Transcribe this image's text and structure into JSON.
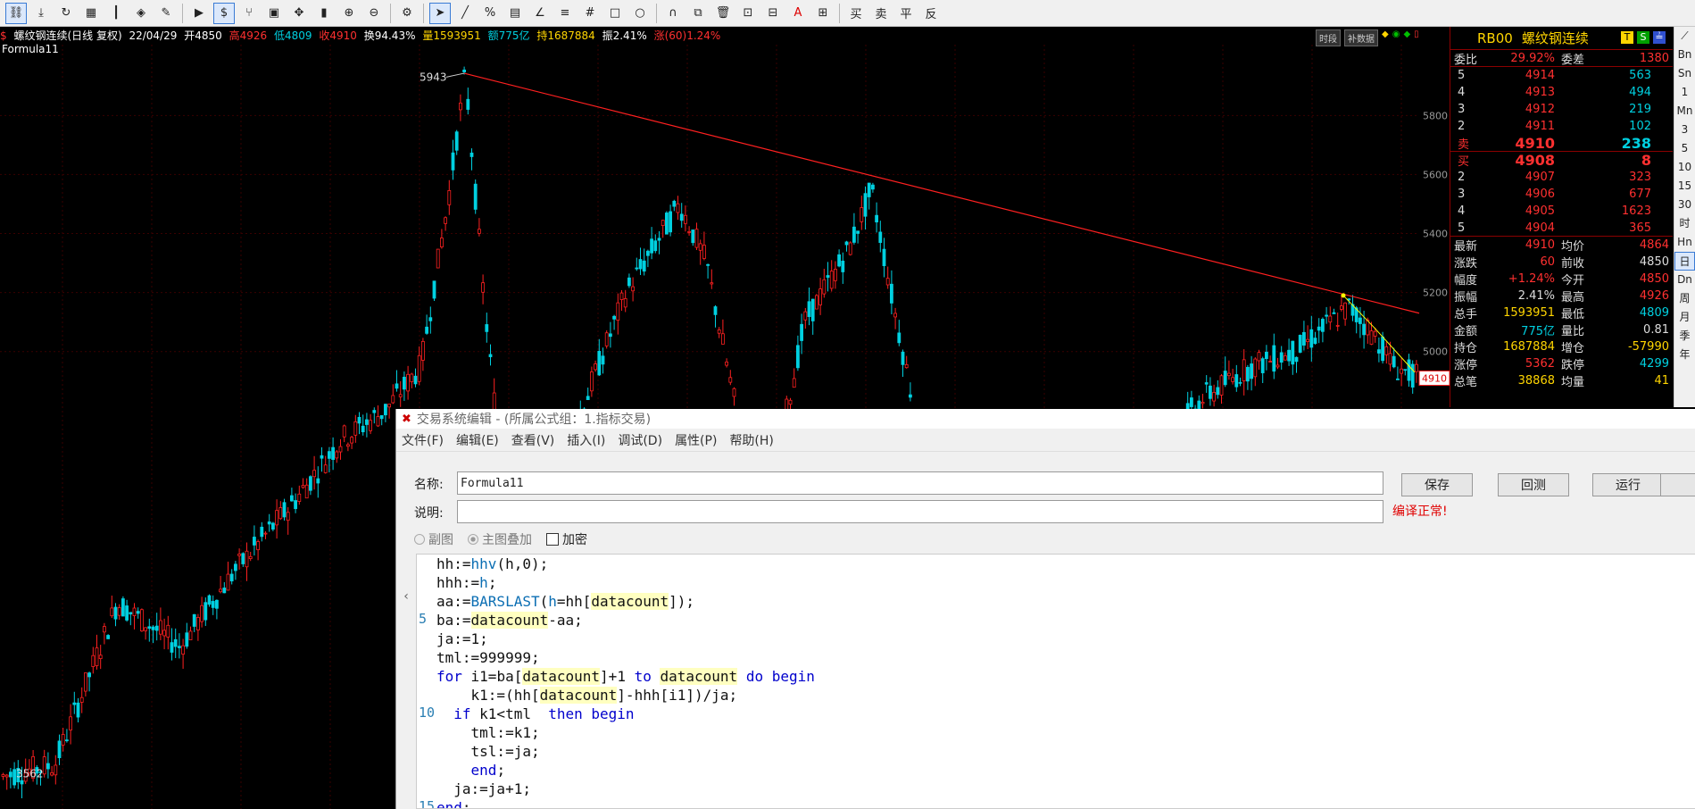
{
  "toolbar": {
    "icons": [
      "link-icon",
      "download-icon",
      "sync-icon",
      "grid-icon",
      "candles-icon",
      "compass-icon",
      "edit-icon",
      "play-icon",
      "dollar-icon",
      "fork-icon",
      "table-icon",
      "move-icon",
      "bar-icon",
      "zoom-in-icon",
      "zoom-out-icon",
      "gear-icon",
      "cursor-icon",
      "line-icon",
      "percent-icon",
      "grid2-icon",
      "angle-icon",
      "channel-icon",
      "hash-icon",
      "rect-icon",
      "circle-icon",
      "magnet-icon",
      "copy-icon",
      "trash-icon",
      "lock-icon",
      "lock2-icon",
      "text-color-icon",
      "save-icon"
    ],
    "text_buttons": [
      "买",
      "卖",
      "平",
      "反"
    ]
  },
  "infobar": {
    "symbol": "螺纹钢连续(日线 复权)",
    "date": "22/04/29",
    "open": "开4850",
    "high": "高4926",
    "low": "低4809",
    "close": "收4910",
    "turnover": "换94.43%",
    "volume": "量1593951",
    "amount": "额775亿",
    "hold": "持1687884",
    "amplitude": "振2.41%",
    "change": "涨(60)1.24%"
  },
  "formula_name": "Formula11",
  "chart_top_btns": [
    "时段",
    "补数据"
  ],
  "chart_labels": {
    "high_label": "5943",
    "low_label": "3562",
    "last_price": "4910"
  },
  "chart_data": {
    "type": "candlestick",
    "y_ticks": [
      5800,
      5600,
      5400,
      5200,
      5000
    ],
    "ylim": [
      3450,
      6040
    ],
    "annotations": [
      "5943",
      "3562",
      "4910"
    ]
  },
  "right_panel": {
    "code": "RB00",
    "name": "螺纹钢连续",
    "weibi": {
      "label": "委比",
      "value": "29.92%",
      "label2": "委差",
      "value2": "1380"
    },
    "asks": [
      {
        "lvl": "5",
        "price": "4914",
        "vol": "563"
      },
      {
        "lvl": "4",
        "price": "4913",
        "vol": "494"
      },
      {
        "lvl": "3",
        "price": "4912",
        "vol": "219"
      },
      {
        "lvl": "2",
        "price": "4911",
        "vol": "102"
      },
      {
        "lvl": "卖",
        "price": "4910",
        "vol": "238"
      }
    ],
    "bids": [
      {
        "lvl": "买",
        "price": "4908",
        "vol": "8"
      },
      {
        "lvl": "2",
        "price": "4907",
        "vol": "323"
      },
      {
        "lvl": "3",
        "price": "4906",
        "vol": "677"
      },
      {
        "lvl": "4",
        "price": "4905",
        "vol": "1623"
      },
      {
        "lvl": "5",
        "price": "4904",
        "vol": "365"
      }
    ],
    "stats": [
      {
        "l1": "最新",
        "v1": "4910",
        "l2": "均价",
        "v2": "4864",
        "c1": "#ff3030",
        "c2": "#ff3030"
      },
      {
        "l1": "涨跌",
        "v1": "60",
        "l2": "前收",
        "v2": "4850",
        "c1": "#ff3030",
        "c2": "#dddddd"
      },
      {
        "l1": "幅度",
        "v1": "+1.24%",
        "l2": "今开",
        "v2": "4850",
        "c1": "#ff3030",
        "c2": "#ff3030"
      },
      {
        "l1": "振幅",
        "v1": "2.41%",
        "l2": "最高",
        "v2": "4926",
        "c1": "#dddddd",
        "c2": "#ff3030"
      },
      {
        "l1": "总手",
        "v1": "1593951",
        "l2": "最低",
        "v2": "4809",
        "c1": "#ffd500",
        "c2": "#00d0e0"
      },
      {
        "l1": "金额",
        "v1": "775亿",
        "l2": "量比",
        "v2": "0.81",
        "c1": "#00d0e0",
        "c2": "#dddddd"
      },
      {
        "l1": "持仓",
        "v1": "1687884",
        "l2": "增仓",
        "v2": "-57990",
        "c1": "#ffd500",
        "c2": "#ffd500"
      },
      {
        "l1": "涨停",
        "v1": "5362",
        "l2": "跌停",
        "v2": "4299",
        "c1": "#ff3030",
        "c2": "#00d0e0"
      },
      {
        "l1": "总笔",
        "v1": "38868",
        "l2": "均量",
        "v2": "41",
        "c1": "#ffd500",
        "c2": "#ffd500"
      }
    ]
  },
  "side_tabs": [
    "Bn",
    "Sn",
    "1",
    "Mn",
    "3",
    "5",
    "10",
    "15",
    "30",
    "时",
    "Hn",
    "日",
    "Dn",
    "周",
    "月",
    "季",
    "年"
  ],
  "editor": {
    "title": "交易系统编辑 - (所属公式组：1.指标交易)",
    "menu": [
      "文件(F)",
      "编辑(E)",
      "查看(V)",
      "插入(I)",
      "调试(D)",
      "属性(P)",
      "帮助(H)"
    ],
    "name_label": "名称:",
    "name_value": "Formula11",
    "desc_label": "说明:",
    "desc_value": "",
    "btn_save": "保存",
    "btn_backtest": "回测",
    "btn_run": "运行",
    "status": "编译正常!",
    "opt_sub": "副图",
    "opt_main": "主图叠加",
    "opt_encrypt": "加密",
    "gutter_5": "5",
    "gutter_10": "10",
    "gutter_15": "15",
    "collapse_glyph": "‹"
  }
}
